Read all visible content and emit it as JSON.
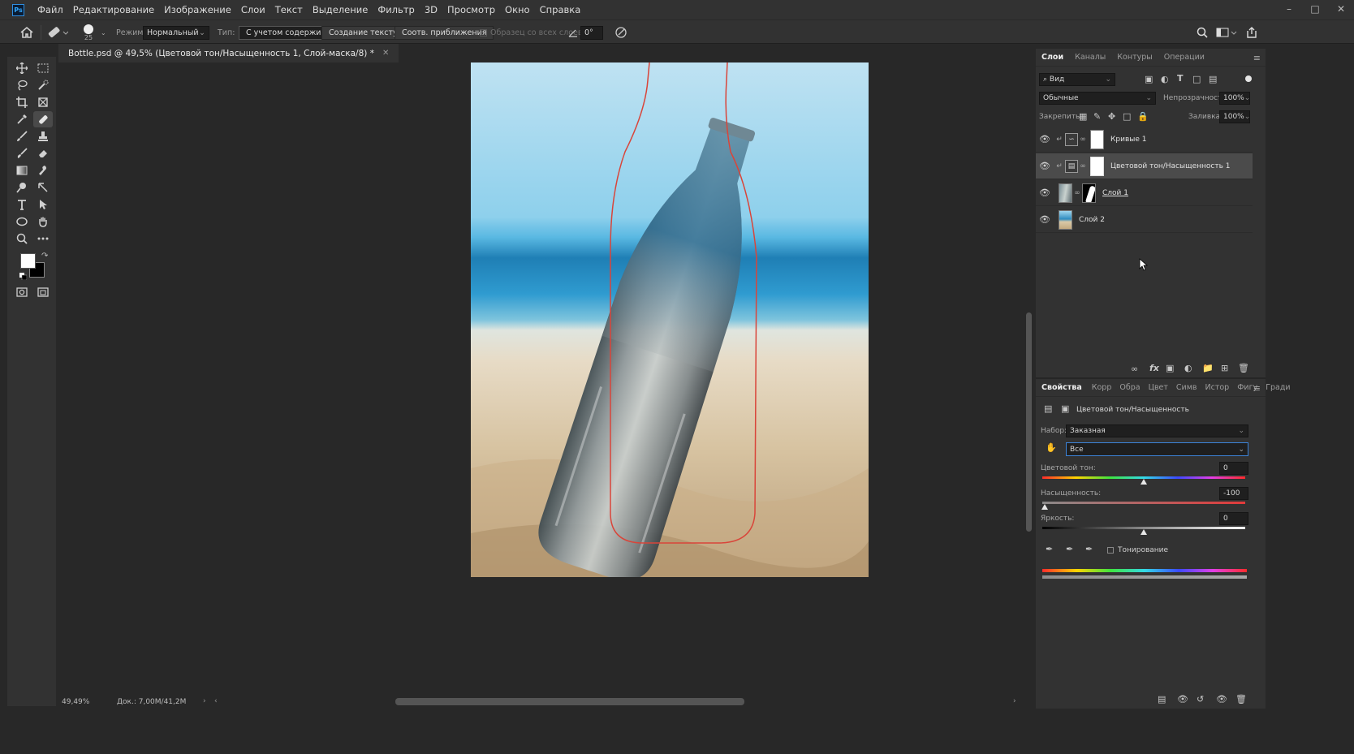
{
  "app": {
    "logo": "Ps"
  },
  "menu": [
    "Файл",
    "Редактирование",
    "Изображение",
    "Слои",
    "Текст",
    "Выделение",
    "Фильтр",
    "3D",
    "Просмотр",
    "Окно",
    "Справка"
  ],
  "options": {
    "brush_size": "25",
    "mode_label": "Режим:",
    "mode_value": "Нормальный",
    "type_label": "Тип:",
    "type_buttons": [
      "С учетом содержимого",
      "Создание текстуры",
      "Соотв. приближения"
    ],
    "sample_all": "Образец со всех слоев",
    "angle": "0°"
  },
  "document": {
    "tab_title": "Bottle.psd @ 49,5% (Цветовой тон/Насыщенность 1, Слой-маска/8) *"
  },
  "status": {
    "zoom": "49,49%",
    "doc": "Док.: 7,00M/41,2M"
  },
  "layers_panel": {
    "tabs": [
      "Слои",
      "Каналы",
      "Контуры",
      "Операции"
    ],
    "filter_label": "Вид",
    "blend_mode": "Обычные",
    "opacity_label": "Непрозрачность:",
    "opacity_value": "100%",
    "lock_label": "Закрепить:",
    "fill_label": "Заливка:",
    "fill_value": "100%",
    "layers": [
      {
        "name": "Кривые 1"
      },
      {
        "name": "Цветовой тон/Насыщенность 1"
      },
      {
        "name": "Слой 1"
      },
      {
        "name": "Слой 2"
      }
    ]
  },
  "properties_panel": {
    "tabs": [
      "Свойства",
      "Корр",
      "Обра",
      "Цвет",
      "Симв",
      "Истор",
      "Фигу",
      "Гради"
    ],
    "title": "Цветовой тон/Насыщенность",
    "preset_label": "Набор:",
    "preset_value": "Заказная",
    "channel_value": "Все",
    "hue_label": "Цветовой тон:",
    "hue_value": "0",
    "saturation_label": "Насыщенность:",
    "saturation_value": "-100",
    "lightness_label": "Яркость:",
    "lightness_value": "0",
    "colorize_label": "Тонирование"
  }
}
